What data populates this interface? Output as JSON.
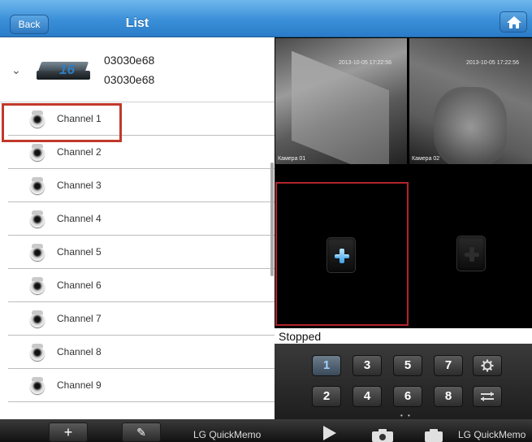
{
  "left_panel": {
    "header": {
      "back_label": "Back",
      "title": "List"
    },
    "device": {
      "badge": "16",
      "line1": "03030e68",
      "line2": "03030e68"
    },
    "channels": [
      "Channel 1",
      "Channel 2",
      "Channel 3",
      "Channel 4",
      "Channel 5",
      "Channel 6",
      "Channel 7",
      "Channel 8",
      "Channel 9"
    ],
    "toolbar": {
      "add_label": "+",
      "edit_label": "✎"
    },
    "watermark": "LG QuickMemo"
  },
  "right_panel": {
    "cameras": [
      {
        "timestamp": "2013-10-05 17:22:56",
        "name": "Камера 01"
      },
      {
        "timestamp": "2013-10-05 17:22:56",
        "name": "Камера 02"
      }
    ],
    "status": "Stopped",
    "channel_buttons_row1": [
      "1",
      "3",
      "5",
      "7"
    ],
    "channel_buttons_row2": [
      "2",
      "4",
      "6",
      "8"
    ],
    "page_dots": "• •",
    "watermark": "LG QuickMemo",
    "colors": {
      "accent_blue": "#3a8fd8",
      "selection_red": "#b3232b"
    }
  }
}
